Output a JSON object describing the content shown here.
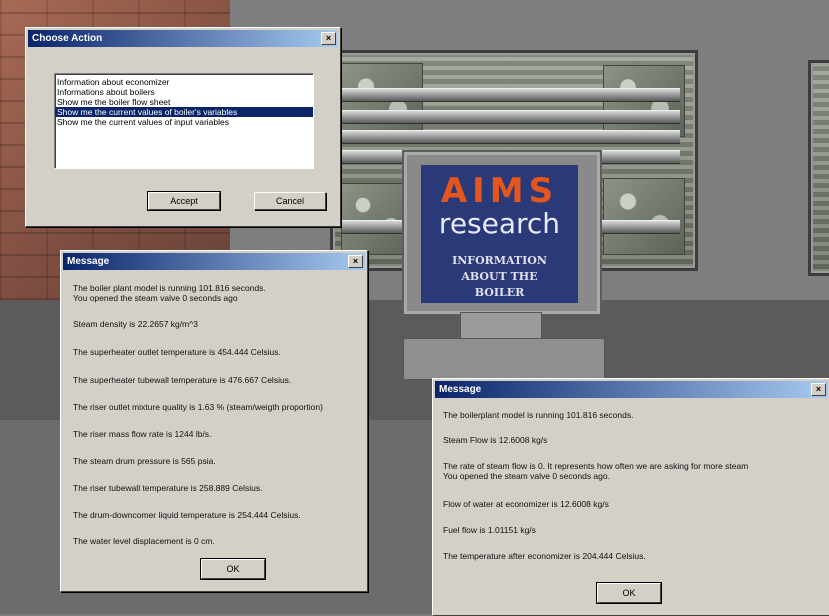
{
  "scene": {
    "sign": {
      "brand_top": "AIMS",
      "brand_bottom": "research",
      "caption_lines": [
        "INFORMATION",
        "ABOUT THE",
        "BOILER"
      ]
    }
  },
  "choose_action": {
    "title": "Choose Action",
    "close_glyph": "×",
    "items": [
      "Information about economizer",
      "Informations about boilers",
      "Show me the boiler flow sheet",
      "Show me the current values of boiler's variables",
      "Show me the current values of input variables"
    ],
    "accept_label": "Accept",
    "cancel_label": "Cancel"
  },
  "message_left": {
    "title": "Message",
    "close_glyph": "×",
    "lines": [
      "The boiler plant model is running 101.816 seconds.",
      "You opened the steam valve 0 seconds ago",
      "Steam density is 22.2657 kg/m^3",
      "The superheater outlet temperature is 454.444 Celsius.",
      "The superheater tubewall temperature is 476.667 Celsius.",
      "The riser outlet mixture quality is 1.63 % (steam/weigth proportion)",
      "The riser mass flow rate is 1244 lb/s.",
      "The steam drum pressure is 565 psia.",
      "The riser tubewall temperature is 258.889 Celsius.",
      "The drum-downcomer liquid temperature is 254.444 Celsius.",
      "The water level displacement is 0 cm."
    ],
    "ok_label": "OK"
  },
  "message_right": {
    "title": "Message",
    "close_glyph": "×",
    "lines": [
      "The boilerplant model is running 101.816 seconds.",
      "Steam Flow is 12.6008 kg/s",
      "The rate of steam flow is 0. It represents how often we are asking for more steam",
      "You opened the steam valve 0 seconds ago.",
      "Flow of water at economizer is 12.6008 kg/s",
      "Fuel flow is 1.01151 kg/s",
      "The temperature after economizer is 204.444 Celsius."
    ],
    "ok_label": "OK"
  }
}
